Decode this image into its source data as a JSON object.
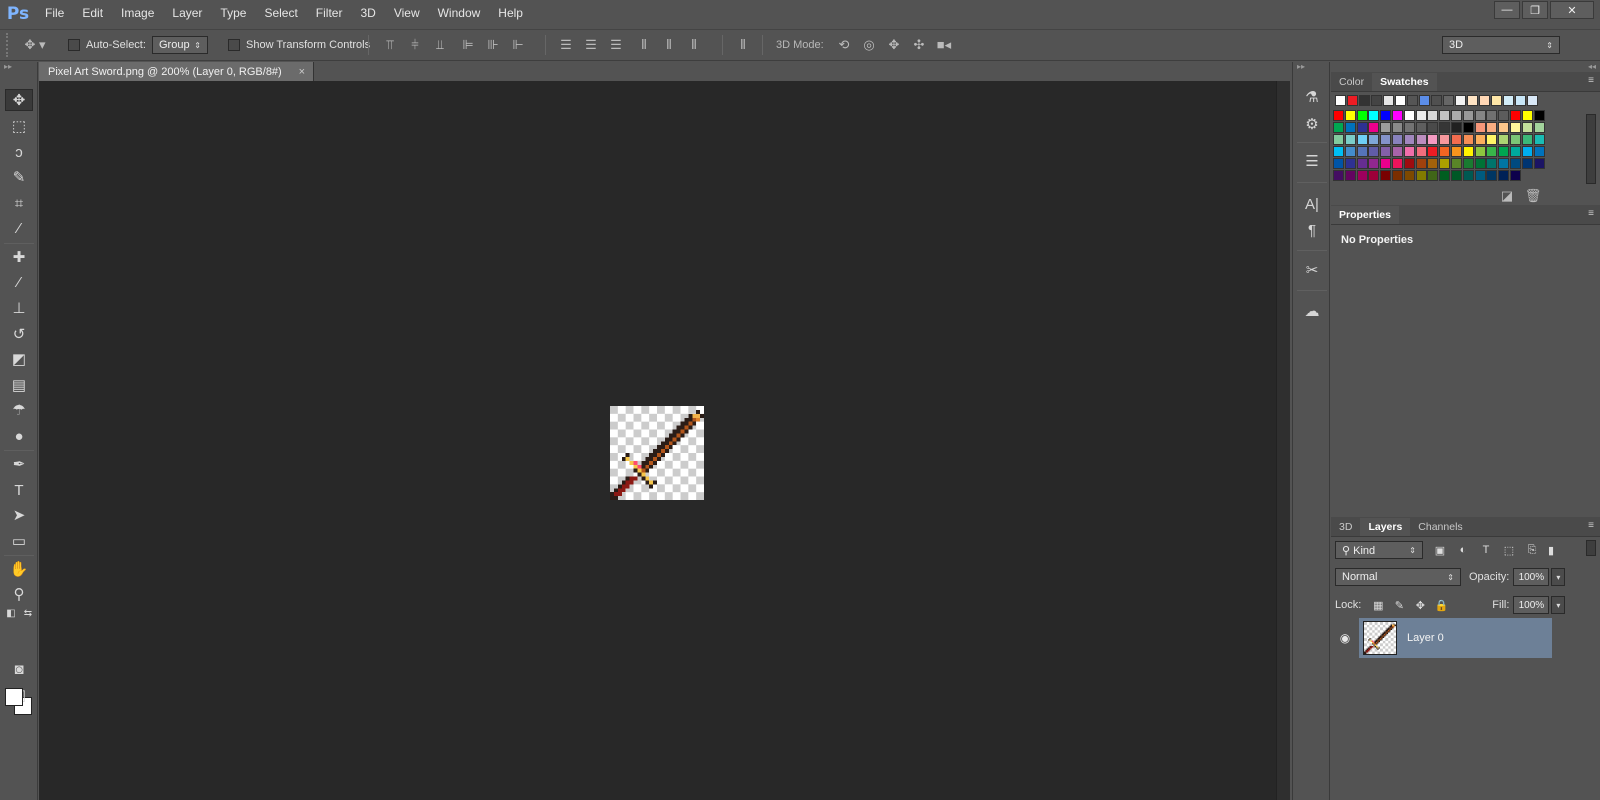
{
  "app": {
    "logo": "Ps"
  },
  "menu": [
    "File",
    "Edit",
    "Image",
    "Layer",
    "Type",
    "Select",
    "Filter",
    "3D",
    "View",
    "Window",
    "Help"
  ],
  "window_controls": {
    "minimize": "—",
    "restore": "❐",
    "close": "✕"
  },
  "options": {
    "auto_select_label": "Auto-Select:",
    "auto_select_value": "Group",
    "show_transform_label": "Show Transform Controls",
    "mode_3d_label": "3D Mode:",
    "workspace_value": "3D"
  },
  "document": {
    "tab_title": "Pixel Art Sword.png @ 200% (Layer 0, RGB/8#)",
    "tab_close": "×"
  },
  "panels": {
    "color_tab": "Color",
    "swatches_tab": "Swatches",
    "properties_tab": "Properties",
    "no_properties": "No Properties",
    "tab_3d": "3D",
    "layers_tab": "Layers",
    "channels_tab": "Channels",
    "filter_kind": "Kind",
    "blend_mode": "Normal",
    "opacity_label": "Opacity:",
    "opacity_value": "100%",
    "lock_label": "Lock:",
    "fill_label": "Fill:",
    "fill_value": "100%",
    "layer_name": "Layer 0"
  },
  "swatch_colors_top": [
    "#ffffff",
    "#ed1c24",
    "#333333",
    "#444444",
    "#e6e6e6",
    "#ffffff",
    "#555555",
    "#5b8de8",
    "#505050",
    "#666666",
    "#f2f2f2",
    "#ffe4c4",
    "#ffd7b5",
    "#ffe7a8",
    "#d2ecf7",
    "#c8e6f7",
    "#d9e8f7"
  ],
  "swatch_colors": [
    "#ff0000",
    "#ffff00",
    "#00ff00",
    "#00ffff",
    "#0000ff",
    "#ff00ff",
    "#ffffff",
    "#ebebeb",
    "#d6d6d6",
    "#c2c2c2",
    "#adadad",
    "#999999",
    "#858585",
    "#707070",
    "#5c5c5c",
    "#ff0000",
    "#ffff00",
    "#000000",
    "#00a651",
    "#0072bc",
    "#2e3192",
    "#ec008c",
    "#9e9e9e",
    "#8a8a8a",
    "#737373",
    "#5e5e5e",
    "#4a4a4a",
    "#363636",
    "#212121",
    "#000000",
    "#f7977a",
    "#f9ad81",
    "#fdc68a",
    "#fff79a",
    "#c4df9b",
    "#a3d39c",
    "#82ca9d",
    "#7bcdc8",
    "#6ecff6",
    "#7ea7d8",
    "#8493ca",
    "#8882be",
    "#a187be",
    "#bc8dbf",
    "#f49ac2",
    "#f6989d",
    "#f26c4f",
    "#f68e56",
    "#fbaf5d",
    "#fff467",
    "#acd373",
    "#7cc576",
    "#3bb878",
    "#1abbb4",
    "#00bff3",
    "#438ccb",
    "#5574b9",
    "#605ca8",
    "#855fa8",
    "#a763a8",
    "#f06eaa",
    "#f26d7d",
    "#ed1c24",
    "#f26522",
    "#f7941d",
    "#fff200",
    "#8dc73f",
    "#39b54a",
    "#00a651",
    "#00a99d",
    "#00aeef",
    "#0072bc",
    "#0054a6",
    "#2e3192",
    "#662d91",
    "#92278f",
    "#ec008c",
    "#ed145b",
    "#9e0b0f",
    "#a0410d",
    "#a3620a",
    "#aba000",
    "#598527",
    "#197b30",
    "#007236",
    "#00746b",
    "#0076a3",
    "#004a80",
    "#003471",
    "#1b1464",
    "#440e62",
    "#630460",
    "#9e005d",
    "#9e0039",
    "#790000",
    "#7b2e00",
    "#7d4900",
    "#827b00",
    "#406618",
    "#005e20",
    "#005826",
    "#005952",
    "#005b7f",
    "#003663",
    "#002157",
    "#0d004c"
  ],
  "canvas_image": {
    "palette": {
      "k": "#2b1d17",
      "o": "#e0822b",
      "y": "#f2b24a",
      "d": "#b3561b",
      "r": "#8c1a14",
      "p": "#ff4a6e",
      "g": "#f7c74a"
    }
  }
}
